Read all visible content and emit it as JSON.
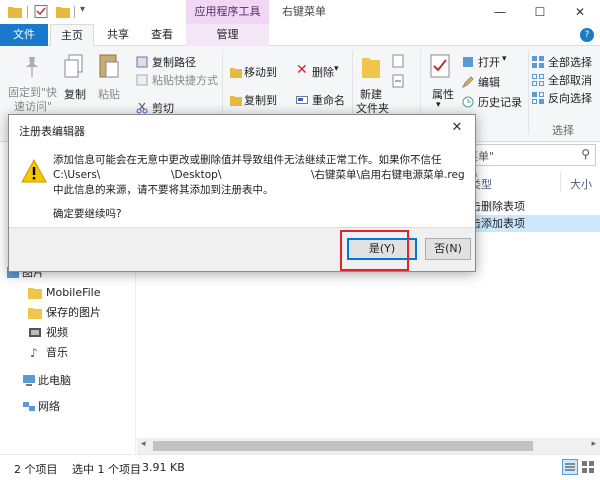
{
  "window": {
    "context_tab_header": "应用程序工具",
    "title": "右键菜单",
    "min_glyph": "—",
    "max_glyph": "☐",
    "close_glyph": "✕"
  },
  "tabs": [
    {
      "label": "文件"
    },
    {
      "label": "主页"
    },
    {
      "label": "共享"
    },
    {
      "label": "查看"
    },
    {
      "label": "管理"
    }
  ],
  "ribbon": {
    "pin_quick_access": "固定到\"快",
    "pin_quick_access_2": "速访问\"",
    "copy": "复制",
    "paste": "粘贴",
    "copy_path": "复制路径",
    "paste_shortcut": "粘贴快捷方式",
    "cut": "剪切",
    "move_to": "移动到",
    "copy_to": "复制到",
    "delete": "删除",
    "rename": "重命名",
    "new_folder": "新建",
    "new_folder_2": "文件夹",
    "properties": "属性",
    "open": "打开",
    "edit": "编辑",
    "history": "历史记录",
    "select_all": "全部选择",
    "select_none": "全部取消",
    "invert_selection": "反向选择",
    "group_select": "选择"
  },
  "nav": [
    {
      "label": "图片"
    },
    {
      "label": "MobileFile"
    },
    {
      "label": "保存的图片"
    },
    {
      "label": "视频"
    },
    {
      "label": "音乐"
    },
    {
      "label": "此电脑"
    },
    {
      "label": "网络"
    }
  ],
  "main": {
    "search_placeholder": "菜单\"",
    "col_type": "类型",
    "col_size": "大小",
    "files": [
      {
        "name": "击删除表项"
      },
      {
        "name": "击添加表项"
      }
    ]
  },
  "status": {
    "item_count": "2 个项目",
    "selected": "选中 1 个项目",
    "size": "3.91 KB"
  },
  "dialog": {
    "title": "注册表编辑器",
    "line1": "添加信息可能会在无意中更改或删除值并导致组件无法继续正常工作。如果你不信任",
    "line2_a": "C:\\Users\\",
    "line2_b": "\\Desktop\\",
    "line2_c": "\\右键菜单\\启用右键电源菜单.reg",
    "line3": "中此信息的来源，请不要将其添加到注册表中。",
    "confirm": "确定要继续吗?",
    "yes": "是(Y)",
    "no": "否(N)"
  },
  "colors": {
    "file_tab": "#1979ca",
    "context_tab": "#f0d8f4",
    "highlight": "#e1232b",
    "selection": "#cce8ff"
  }
}
